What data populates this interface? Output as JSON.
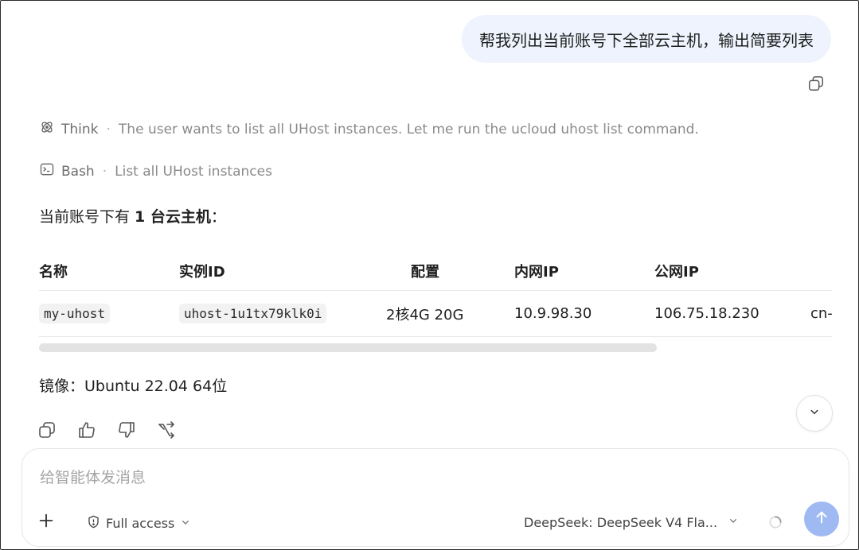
{
  "user_message": "帮我列出当前账号下全部云主机，输出简要列表",
  "think": {
    "label": "Think",
    "text": "The user wants to list all UHost instances. Let me run the ucloud uhost list command."
  },
  "bash": {
    "label": "Bash",
    "text": "List all UHost instances"
  },
  "summary": {
    "prefix": "当前账号下有 ",
    "count": "1 台云主机",
    "suffix": "："
  },
  "table": {
    "headers": [
      "名称",
      "实例ID",
      "配置",
      "内网IP",
      "公网IP",
      ""
    ],
    "rows": [
      {
        "name": "my-uhost",
        "instance_id": "uhost-1u1tx79klk0i",
        "config": "2核4G 20G",
        "private_ip": "10.9.98.30",
        "public_ip": "106.75.18.230",
        "region": "cn-"
      }
    ]
  },
  "image_line": "镜像：Ubuntu 22.04 64位",
  "composer": {
    "placeholder": "给智能体发消息",
    "access_label": "Full access",
    "model_label": "DeepSeek: DeepSeek V4 Fla..."
  },
  "colors": {
    "user_bubble": "#eef3fd",
    "send_button": "#9fb9f2"
  }
}
